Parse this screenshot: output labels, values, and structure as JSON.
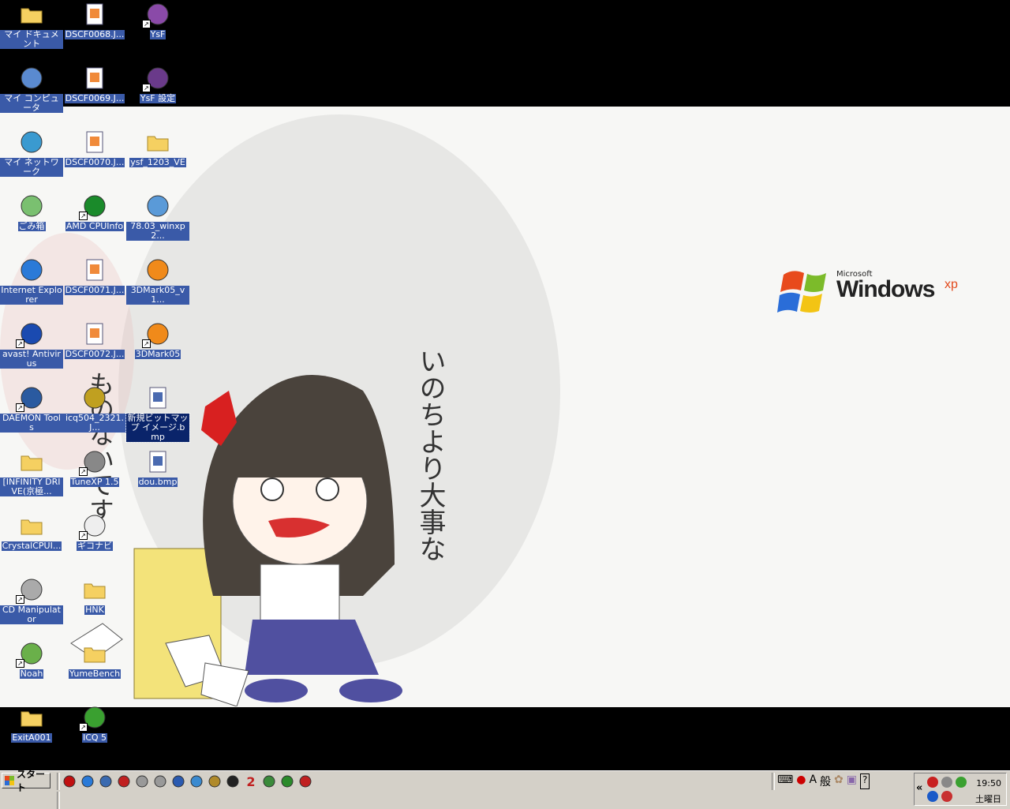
{
  "desktop": {
    "wallpaper_logo": {
      "microsoft": "Microsoft",
      "windows": "Windows",
      "xp": "xp"
    },
    "wallpaper_text_vertical": "いのちより大事な",
    "wallpaper_text_vertical2": "ものないです",
    "icons": [
      {
        "label": "マイ ドキュメント",
        "icon": "folder-documents-icon",
        "shortcut": false
      },
      {
        "label": "DSCF0068.J...",
        "icon": "image-file-icon",
        "shortcut": false
      },
      {
        "label": "YsF",
        "icon": "app-icon",
        "shortcut": true
      },
      {
        "label": "マイ コンピュータ",
        "icon": "computer-icon",
        "shortcut": false
      },
      {
        "label": "DSCF0069.J...",
        "icon": "image-file-icon",
        "shortcut": false
      },
      {
        "label": "YsF 設定",
        "icon": "app-settings-icon",
        "shortcut": true
      },
      {
        "label": "マイ ネットワーク",
        "icon": "network-icon",
        "shortcut": false
      },
      {
        "label": "DSCF0070.J...",
        "icon": "image-file-icon",
        "shortcut": false
      },
      {
        "label": "ysf_1203_VE",
        "icon": "folder-icon",
        "shortcut": false
      },
      {
        "label": "ごみ箱",
        "icon": "recycle-bin-icon",
        "shortcut": false
      },
      {
        "label": "AMD CPUInfo",
        "icon": "amd-icon",
        "shortcut": true
      },
      {
        "label": "78.03_winxp2...",
        "icon": "installer-icon",
        "shortcut": false
      },
      {
        "label": "Internet Explorer",
        "icon": "internet-explorer-icon",
        "shortcut": false
      },
      {
        "label": "DSCF0071.J...",
        "icon": "image-file-icon",
        "shortcut": false
      },
      {
        "label": "3DMark05_v1...",
        "icon": "3dmark-icon",
        "shortcut": false
      },
      {
        "label": "avast! Antivirus",
        "icon": "avast-icon",
        "shortcut": true
      },
      {
        "label": "DSCF0072.J...",
        "icon": "image-file-icon",
        "shortcut": false
      },
      {
        "label": "3DMark05",
        "icon": "3dmark-icon",
        "shortcut": true
      },
      {
        "label": "DAEMON Tools",
        "icon": "daemon-tools-icon",
        "shortcut": true
      },
      {
        "label": "icq504_2321.J...",
        "icon": "lzh-archive-icon",
        "shortcut": false
      },
      {
        "label": "新規ビットマップ イメージ.bmp",
        "icon": "paint-bitmap-icon",
        "shortcut": false,
        "selected": true
      },
      {
        "label": "[INFINITY DRIVE(京極...",
        "icon": "folder-icon",
        "shortcut": false
      },
      {
        "label": "TuneXP 1.5",
        "icon": "tunexp-icon",
        "shortcut": true
      },
      {
        "label": "dou.bmp",
        "icon": "paint-bitmap-icon",
        "shortcut": false
      },
      {
        "label": "CrystalCPUI...",
        "icon": "folder-icon",
        "shortcut": false
      },
      {
        "label": "ギコナビ",
        "icon": "gikonavi-icon",
        "shortcut": true
      },
      {
        "label": "CD Manipulator",
        "icon": "cd-icon",
        "shortcut": true
      },
      {
        "label": "HNK",
        "icon": "folder-icon",
        "shortcut": false
      },
      {
        "label": "Noah",
        "icon": "noah-icon",
        "shortcut": true
      },
      {
        "label": "YumeBench",
        "icon": "folder-icon",
        "shortcut": false
      },
      {
        "label": "ExitA001",
        "icon": "folder-icon",
        "shortcut": false
      },
      {
        "label": "ICQ 5",
        "icon": "icq-flower-icon",
        "shortcut": true
      }
    ]
  },
  "taskbar": {
    "start_label": "スタート",
    "quick_launch": [
      "acrobat-icon",
      "ie-icon",
      "ie-browser-icon",
      "opera-icon",
      "drive-icon",
      "drive-icon",
      "media-player-icon",
      "app-icon",
      "pen-icon",
      "puzzle-icon",
      "number-2-icon",
      "triangle-icon",
      "circle-icon",
      "firewall-icon"
    ],
    "quick_launch_2_label": "2",
    "ime": {
      "mode": "A",
      "label": "般",
      "help": "?"
    },
    "tray_chevron": "«",
    "clock_time": "19:50",
    "clock_day": "土曜日"
  },
  "colors": {
    "selection": "#3a5aa8",
    "taskbar": "#d4d0c8"
  }
}
